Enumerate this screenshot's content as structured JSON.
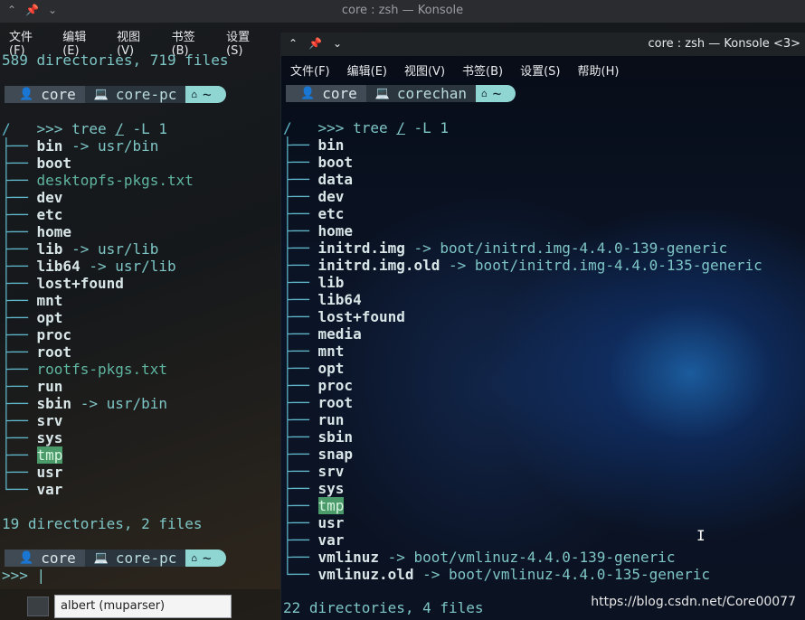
{
  "back": {
    "title": "core : zsh — Konsole",
    "menu": [
      "文件(F)",
      "编辑(E)",
      "视图(V)",
      "书签(B)",
      "设置(S)"
    ],
    "summary_top": "589 directories, 719 files",
    "prompt": {
      "user": "core",
      "host": "core-pc",
      "path": "~"
    },
    "command": {
      "prefix": ">>>",
      "cmd": "tree",
      "arg1": "/",
      "arg2": "-L 1"
    },
    "root": "/",
    "entries": [
      {
        "name": "bin",
        "kind": "link",
        "target": "usr/bin"
      },
      {
        "name": "boot",
        "kind": "dir"
      },
      {
        "name": "desktopfs-pkgs.txt",
        "kind": "file"
      },
      {
        "name": "dev",
        "kind": "dir"
      },
      {
        "name": "etc",
        "kind": "dir"
      },
      {
        "name": "home",
        "kind": "dir"
      },
      {
        "name": "lib",
        "kind": "link",
        "target": "usr/lib"
      },
      {
        "name": "lib64",
        "kind": "link",
        "target": "usr/lib"
      },
      {
        "name": "lost+found",
        "kind": "dir"
      },
      {
        "name": "mnt",
        "kind": "dir"
      },
      {
        "name": "opt",
        "kind": "dir"
      },
      {
        "name": "proc",
        "kind": "dir"
      },
      {
        "name": "root",
        "kind": "dir"
      },
      {
        "name": "rootfs-pkgs.txt",
        "kind": "file"
      },
      {
        "name": "run",
        "kind": "dir"
      },
      {
        "name": "sbin",
        "kind": "link",
        "target": "usr/bin"
      },
      {
        "name": "srv",
        "kind": "dir"
      },
      {
        "name": "sys",
        "kind": "dir"
      },
      {
        "name": "tmp",
        "kind": "hl"
      },
      {
        "name": "usr",
        "kind": "dir"
      },
      {
        "name": "var",
        "kind": "dir"
      }
    ],
    "summary": "19 directories, 2 files",
    "prompt2": {
      "user": "core",
      "host": "core-pc",
      "path": "~"
    },
    "prompt2_prefix": ">>>",
    "taskbar_input": "albert (muparser)"
  },
  "front": {
    "title": "core : zsh — Konsole <3>",
    "menu": [
      "文件(F)",
      "编辑(E)",
      "视图(V)",
      "书签(B)",
      "设置(S)",
      "帮助(H)"
    ],
    "prompt": {
      "user": "core",
      "host": "corechan",
      "path": "~"
    },
    "command": {
      "prefix": ">>>",
      "cmd": "tree",
      "arg1": "/",
      "arg2": "-L 1"
    },
    "root": "/",
    "entries": [
      {
        "name": "bin",
        "kind": "dir"
      },
      {
        "name": "boot",
        "kind": "dir"
      },
      {
        "name": "data",
        "kind": "dir"
      },
      {
        "name": "dev",
        "kind": "dir"
      },
      {
        "name": "etc",
        "kind": "dir"
      },
      {
        "name": "home",
        "kind": "dir"
      },
      {
        "name": "initrd.img",
        "kind": "link",
        "target": "boot/initrd.img-4.4.0-139-generic"
      },
      {
        "name": "initrd.img.old",
        "kind": "link",
        "target": "boot/initrd.img-4.4.0-135-generic"
      },
      {
        "name": "lib",
        "kind": "dir"
      },
      {
        "name": "lib64",
        "kind": "dir"
      },
      {
        "name": "lost+found",
        "kind": "dir"
      },
      {
        "name": "media",
        "kind": "dir"
      },
      {
        "name": "mnt",
        "kind": "dir"
      },
      {
        "name": "opt",
        "kind": "dir"
      },
      {
        "name": "proc",
        "kind": "dir"
      },
      {
        "name": "root",
        "kind": "dir"
      },
      {
        "name": "run",
        "kind": "dir"
      },
      {
        "name": "sbin",
        "kind": "dir"
      },
      {
        "name": "snap",
        "kind": "dir"
      },
      {
        "name": "srv",
        "kind": "dir"
      },
      {
        "name": "sys",
        "kind": "dir"
      },
      {
        "name": "tmp",
        "kind": "hl"
      },
      {
        "name": "usr",
        "kind": "dir"
      },
      {
        "name": "var",
        "kind": "dir"
      },
      {
        "name": "vmlinuz",
        "kind": "link",
        "target": "boot/vmlinuz-4.4.0-139-generic"
      },
      {
        "name": "vmlinuz.old",
        "kind": "link",
        "target": "boot/vmlinuz-4.4.0-135-generic"
      }
    ],
    "summary": "22 directories, 4 files"
  },
  "watermark": "https://blog.csdn.net/Core00077",
  "icons": {
    "keep_above": "pin-icon",
    "shade": "chevron-up-icon",
    "minimize": "chevron-down-icon",
    "user": "person-icon",
    "host": "laptop-icon",
    "home": "home-icon"
  }
}
